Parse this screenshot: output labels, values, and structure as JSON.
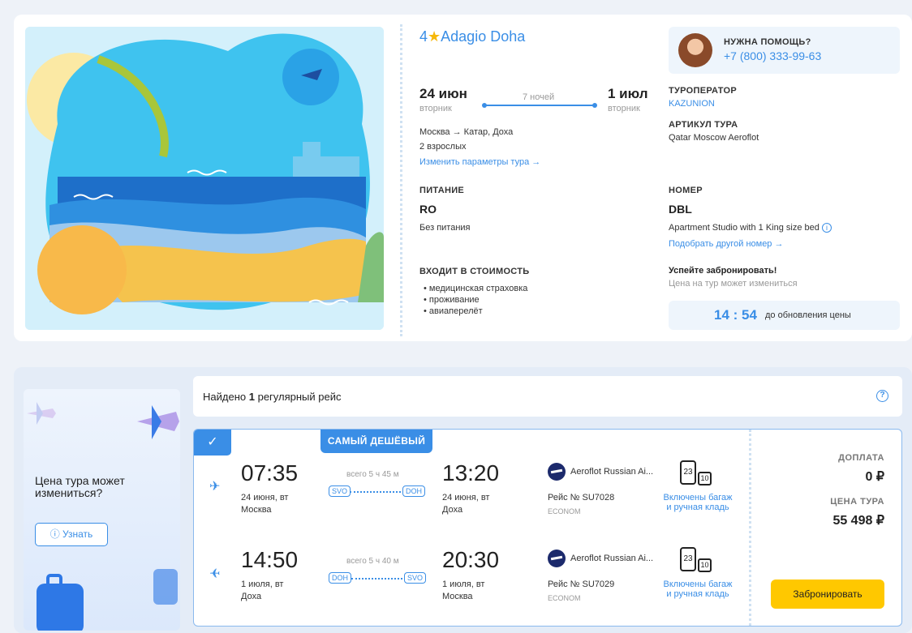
{
  "hotel": {
    "stars": "4",
    "star_glyph": "★",
    "name": "Adagio Doha"
  },
  "dates": {
    "start": "24 июн",
    "start_day": "вторник",
    "nights": "7 ночей",
    "end": "1 июл",
    "end_day": "вторник"
  },
  "route": "Москва → Катар, Доха",
  "guests": "2 взрослых",
  "change_params": "Изменить параметры тура  →",
  "meal": {
    "caption": "ПИТАНИЕ",
    "code": "RO",
    "desc": "Без питания"
  },
  "includes": {
    "caption": "ВХОДИТ В СТОИМОСТЬ",
    "items": [
      "медицинская страховка",
      "проживание",
      "авиаперелёт"
    ]
  },
  "help": {
    "title": "НУЖНА ПОМОЩЬ?",
    "phone": "+7 (800) 333-99-63"
  },
  "operator": {
    "caption": "ТУРОПЕРАТОР",
    "name": "KAZUNION"
  },
  "article": {
    "caption": "АРТИКУЛ ТУРА",
    "value": "Qatar Moscow Aeroflot"
  },
  "room": {
    "caption": "НОМЕР",
    "code": "DBL",
    "desc": "Apartment Studio with 1 King size bed",
    "change": "Подобрать другой номер  →"
  },
  "hurry": {
    "title": "Успейте забронировать!",
    "sub": "Цена на тур может измениться"
  },
  "timer": {
    "value": "14 : 54",
    "label": "до обновления цены"
  },
  "side": {
    "text": "Цена тура может измениться?",
    "button": "Узнать"
  },
  "found": {
    "prefix": "Найдено",
    "count": "1",
    "suffix": "регулярный рейс"
  },
  "badge": "САМЫЙ ДЕШЁВЫЙ",
  "flights": [
    {
      "dep_time": "07:35",
      "dep_date": "24 июня, вт",
      "dep_city": "Москва",
      "duration": "всего 5 ч 45 м",
      "from": "SVO",
      "to": "DOH",
      "arr_time": "13:20",
      "arr_date": "24 июня, вт",
      "arr_city": "Доха",
      "airline": "Aeroflot Russian Ai...",
      "flight_no": "Рейс № SU7028",
      "class": "ECONOM",
      "bag1": "23",
      "bag2": "10",
      "bag_text": "Включены багаж и ручная кладь"
    },
    {
      "dep_time": "14:50",
      "dep_date": "1 июля, вт",
      "dep_city": "Доха",
      "duration": "всего 5 ч 40 м",
      "from": "DOH",
      "to": "SVO",
      "arr_time": "20:30",
      "arr_date": "1 июля, вт",
      "arr_city": "Москва",
      "airline": "Aeroflot Russian Ai...",
      "flight_no": "Рейс № SU7029",
      "class": "ECONOM",
      "bag1": "23",
      "bag2": "10",
      "bag_text": "Включены багаж и ручная кладь"
    }
  ],
  "price": {
    "extra_caption": "ДОПЛАТА",
    "extra_value": "0 ₽",
    "total_caption": "ЦЕНА ТУРА",
    "total_value": "55 498 ₽",
    "book": "Забронировать"
  }
}
